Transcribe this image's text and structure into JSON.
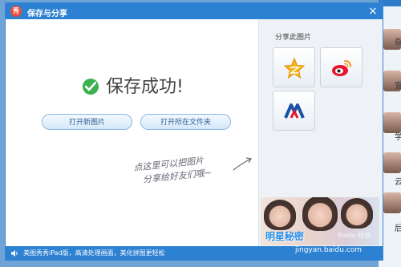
{
  "window": {
    "logo_text": "秀",
    "title": "保存与分享",
    "close_glyph": "×"
  },
  "main": {
    "success_message": "保存成功!",
    "open_new_button": "打开新图片",
    "open_folder_button": "打开所在文件夹",
    "hint_line1": "点这里可以把图片",
    "hint_line2": "分享给好友们哦~"
  },
  "side": {
    "share_label": "分享此图片",
    "share_targets": [
      "qq-zone",
      "weibo",
      "renren"
    ],
    "ad_text": "明星秘密",
    "ad_watermark": "Baidu 经验"
  },
  "status": {
    "text": "美图秀秀iPad版，高清处理画面，美化拼图更轻松"
  },
  "watermark": {
    "text": "jingyan.baidu.com"
  },
  "background_window": {
    "chars": [
      "杂",
      "宜",
      "学",
      "云",
      "后"
    ]
  },
  "colors": {
    "titlebar": "#2c81d2",
    "success_green": "#3db04f",
    "weibo_red": "#e6162d",
    "qzone_yellow": "#f6b91d",
    "renren_blue": "#1a4fa3"
  }
}
